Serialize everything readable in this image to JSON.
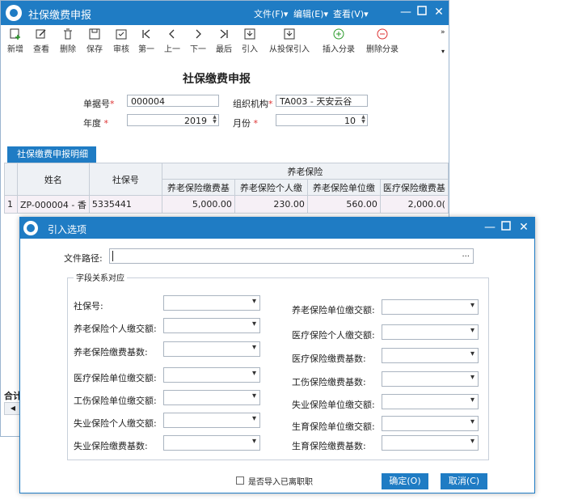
{
  "main": {
    "title": "社保缴费申报",
    "menus": [
      "文件(F)▾",
      "编辑(E)▾",
      "查看(V)▾"
    ],
    "toolbar": [
      "新增",
      "查看",
      "删除",
      "保存",
      "审核",
      "第一",
      "上一",
      "下一",
      "最后",
      "引入",
      "从投保引入",
      "插入分录",
      "删除分录"
    ],
    "heading": "社保缴费申报",
    "fields": {
      "bill_no_label": "单据号",
      "bill_no_value": "000004",
      "org_label": "组织机构",
      "org_value": "TA003 - 天安云谷",
      "year_label": "年度",
      "year_value": "2019",
      "month_label": "月份",
      "month_value": "10",
      "required_mark": "*"
    },
    "tab": "社保缴费申报明细",
    "grid": {
      "col_name": "姓名",
      "col_ssn": "社保号",
      "group_header": "养老保险",
      "sub_headers": [
        "养老保险缴费基",
        "养老保险个人缴",
        "养老保险单位缴",
        "医疗保险缴费基"
      ],
      "row": {
        "index": "1",
        "name": "ZP-000004 - 香",
        "ssn": "5335441",
        "values": [
          "5,000.00",
          "230.00",
          "560.00",
          "2,000.0("
        ]
      },
      "footer": "合计"
    }
  },
  "dialog": {
    "title": "引入选项",
    "file_path_label": "文件路径:",
    "file_path_value": "",
    "browse_label": "...",
    "group_title": "字段关系对应",
    "left_fields": [
      "社保号:",
      "养老保险个人缴交额:",
      "养老保险缴费基数:",
      "医疗保险单位缴交额:",
      "工伤保险单位缴交额:",
      "失业保险个人缴交额:",
      "失业保险缴费基数:"
    ],
    "right_fields": [
      "养老保险单位缴交额:",
      "医疗保险个人缴交额:",
      "医疗保险缴费基数:",
      "工伤保险缴费基数:",
      "失业保险单位缴交额:",
      "生育保险单位缴交额:",
      "生育保险缴费基数:"
    ],
    "checkbox_label": "是否导入已离职职",
    "ok_label": "确定(O)",
    "cancel_label": "取消(C)"
  },
  "colors": {
    "accent": "#1f7cc4"
  }
}
